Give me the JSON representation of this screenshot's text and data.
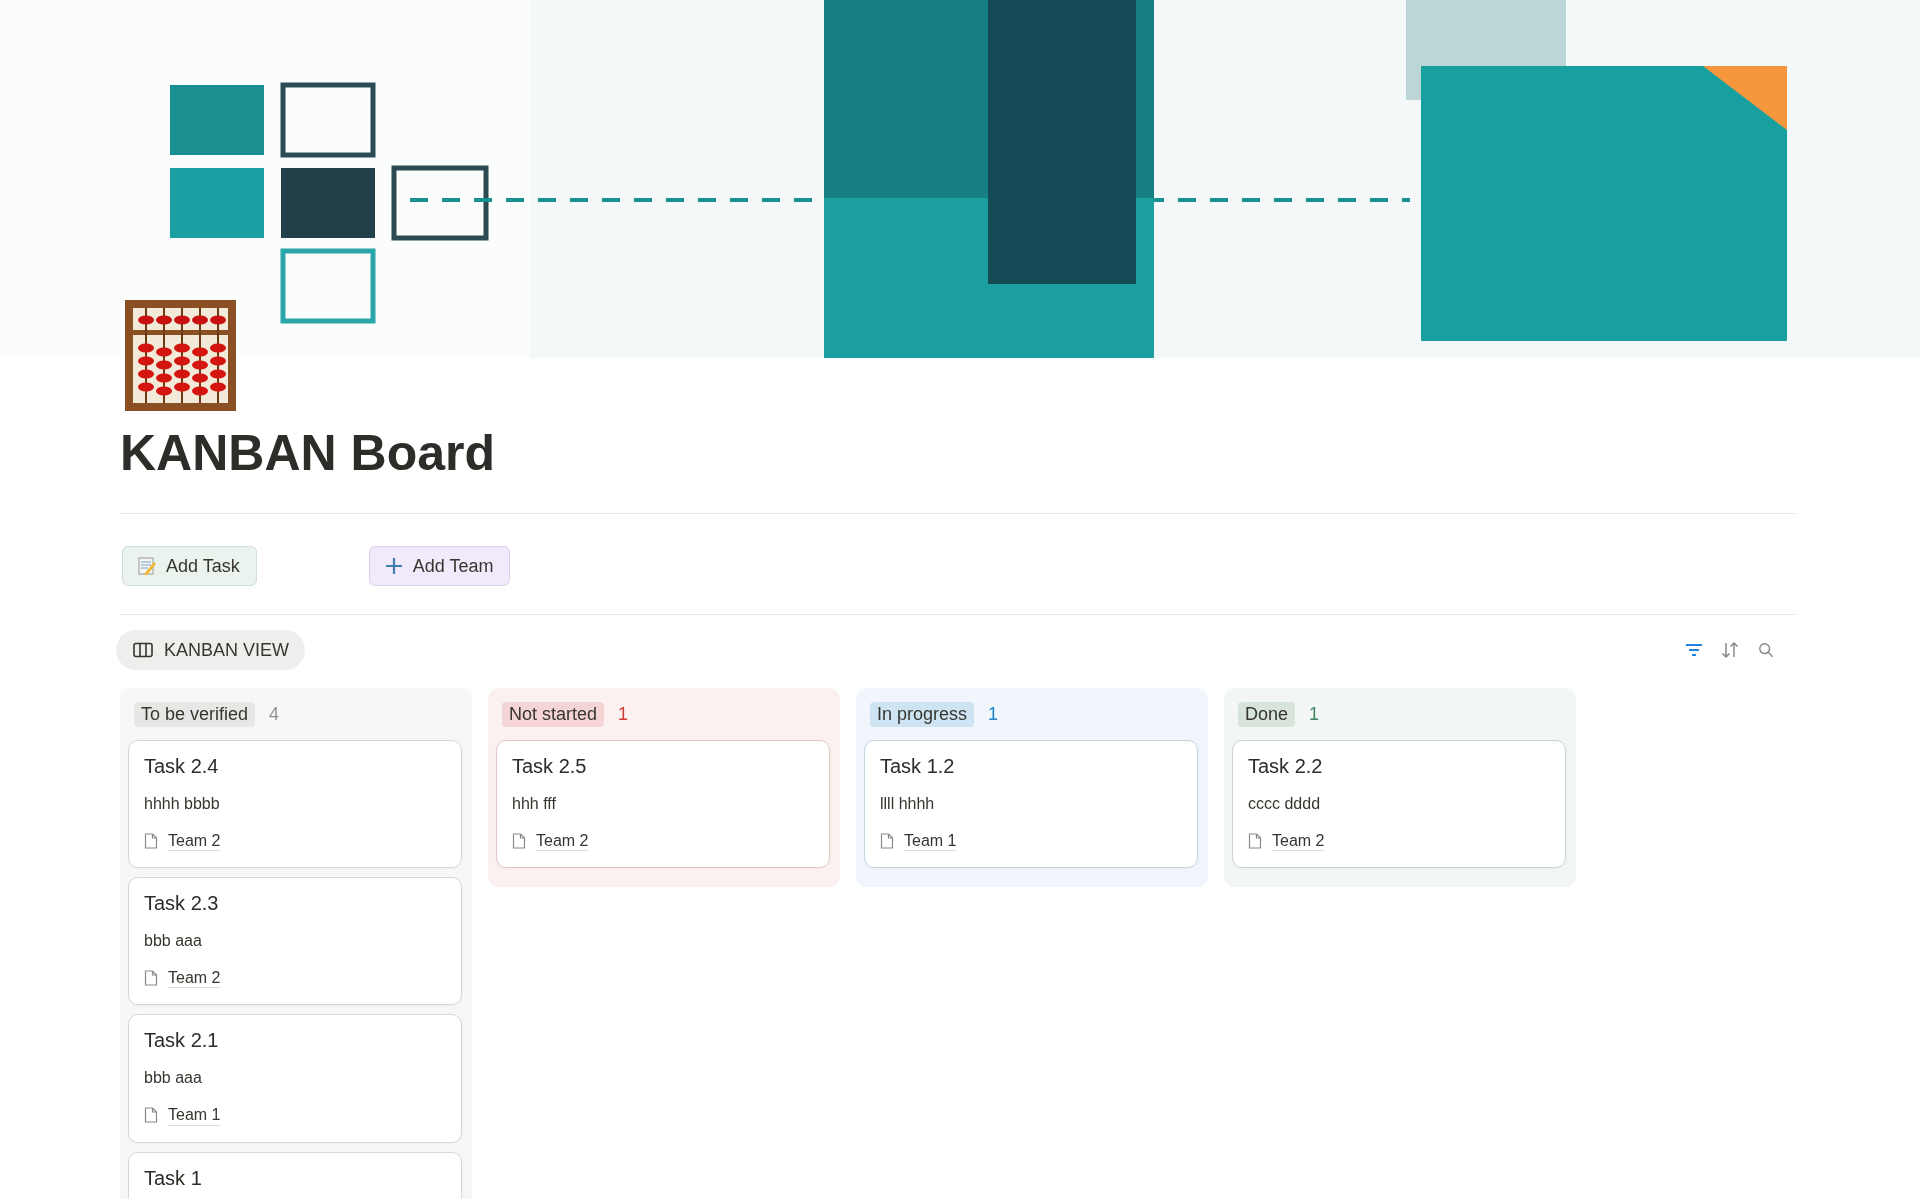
{
  "page": {
    "title": "KANBAN Board"
  },
  "buttons": [
    {
      "label": "Add Task",
      "kind": "memo"
    },
    {
      "label": "Add Team",
      "kind": "plus"
    }
  ],
  "view_tab": {
    "label": "KANBAN VIEW"
  },
  "columns": [
    {
      "status": "To be verified",
      "count": "4",
      "color": "#91918e",
      "cards": [
        {
          "title": "Task 2.4",
          "text": "hhhh bbbb",
          "team": "Team 2"
        },
        {
          "title": "Task 2.3",
          "text": "bbb aaa",
          "team": "Team 2"
        },
        {
          "title": "Task 2.1",
          "text": "bbb aaa",
          "team": "Team 1"
        },
        {
          "title": "Task 1"
        }
      ]
    },
    {
      "status": "Not started",
      "count": "1",
      "color": "#cd3c3a",
      "cards": [
        {
          "title": "Task 2.5",
          "text": "hhh fff",
          "team": "Team 2"
        }
      ]
    },
    {
      "status": "In progress",
      "count": "1",
      "color": "#2383c8",
      "cards": [
        {
          "title": "Task 1.2",
          "text": "llll hhhh",
          "team": "Team 1"
        }
      ]
    },
    {
      "status": "Done",
      "count": "1",
      "color": "#448361",
      "cards": [
        {
          "title": "Task 2.2",
          "text": "cccc dddd",
          "team": "Team 2"
        }
      ]
    }
  ]
}
